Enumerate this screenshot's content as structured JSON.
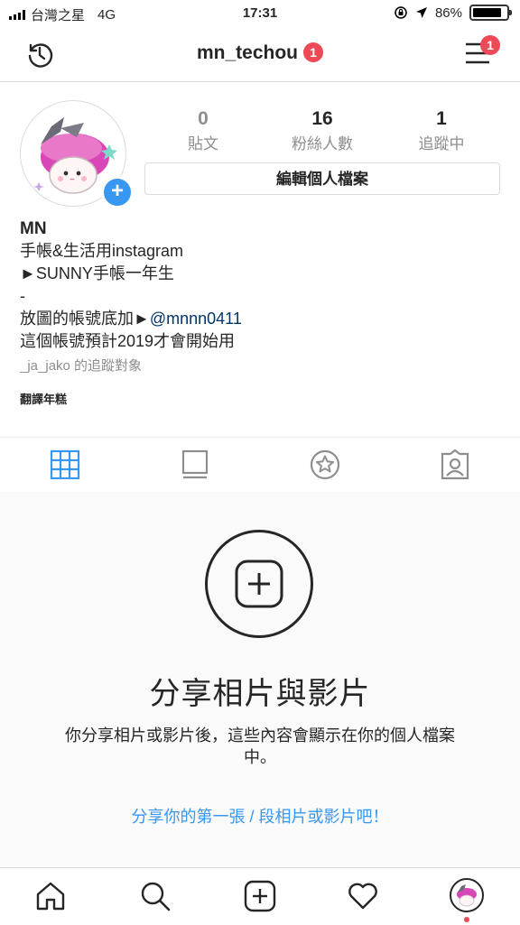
{
  "status_bar": {
    "carrier": "台灣之星",
    "network": "4G",
    "time": "17:31",
    "battery": "86%",
    "battery_level": 0.86
  },
  "header": {
    "username": "mn_techou",
    "username_badge": "1",
    "menu_badge": "1"
  },
  "profile": {
    "stats": [
      {
        "value": "0",
        "label": "貼文"
      },
      {
        "value": "16",
        "label": "粉絲人數"
      },
      {
        "value": "1",
        "label": "追蹤中"
      }
    ],
    "edit_button": "編輯個人檔案",
    "name": "MN",
    "bio_line1": "手帳&生活用instagram",
    "bio_line2": "►SUNNY手帳一年生",
    "bio_line3": "-",
    "bio_line4_prefix": "放圖的帳號底加►",
    "bio_line4_mention": "@mnnn0411",
    "bio_line5": "這個帳號預計2019才會開始用",
    "followed_by": "_ja_jako 的追蹤對象",
    "translate": "翻譯年糕"
  },
  "tabs": {
    "active": "grid",
    "items": [
      "grid-icon",
      "feed-icon",
      "saved-star-icon",
      "tagged-icon"
    ]
  },
  "empty_state": {
    "title": "分享相片與影片",
    "description": "你分享相片或影片後，這些內容會顯示在你的個人檔案中。",
    "link": "分享你的第一張 / 段相片或影片吧！"
  },
  "colors": {
    "accent": "#3897f0",
    "badge": "#ed4956",
    "text": "#262626",
    "muted": "#8e8e8e"
  }
}
